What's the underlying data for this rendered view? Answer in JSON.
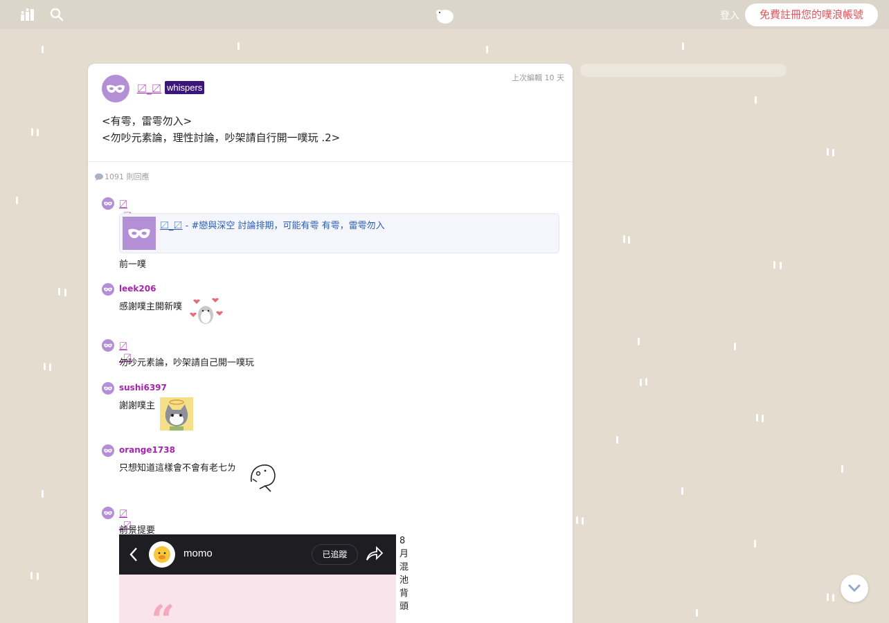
{
  "topbar": {
    "login_label": "登入",
    "signup_label": "免費註冊您的噗浪帳號"
  },
  "post": {
    "edited": "上次編輯 10 天",
    "author": "〼_〼",
    "badge": "whispers",
    "lines": [
      "<有雩，雷雩勿入>",
      "<勿吵元素論，理性討論，吵架請自行開一噗玩 .2>"
    ],
    "response_count": "1091 則回應"
  },
  "responses": [
    {
      "name": "〼_〼",
      "preview": {
        "title_name": "〼_〼",
        "title_rest": " - #戀與深空 討論排期，可能有雩 有雩，雷雩勿入"
      },
      "text": "前一噗"
    },
    {
      "name": "leek206",
      "text": "感謝噗主開新噗"
    },
    {
      "name": "〼_〼",
      "text": "勿吵元素論，吵架請自己開一噗玩"
    },
    {
      "name": "sushi6397",
      "text": "謝謝噗主"
    },
    {
      "name": "orange1738",
      "text": "只想知道這樣會不會有老七ㄌ"
    },
    {
      "name": "〼_〼",
      "text": "前景提要",
      "image": {
        "profile_name": "momo",
        "follow_label": "已追蹤"
      },
      "side_note": "8月混池背頭"
    }
  ],
  "colors": {
    "background": "#e4dccf",
    "username": "#a524b0",
    "badge": "#3c157a",
    "signup_text": "#e2515a",
    "link": "#2a5db0"
  },
  "icons": [
    "stats-icon",
    "search-icon",
    "plurk-logo-icon",
    "mask-avatar-icon",
    "comment-icon",
    "chevron-down-icon",
    "back-arrow-icon",
    "share-icon"
  ]
}
